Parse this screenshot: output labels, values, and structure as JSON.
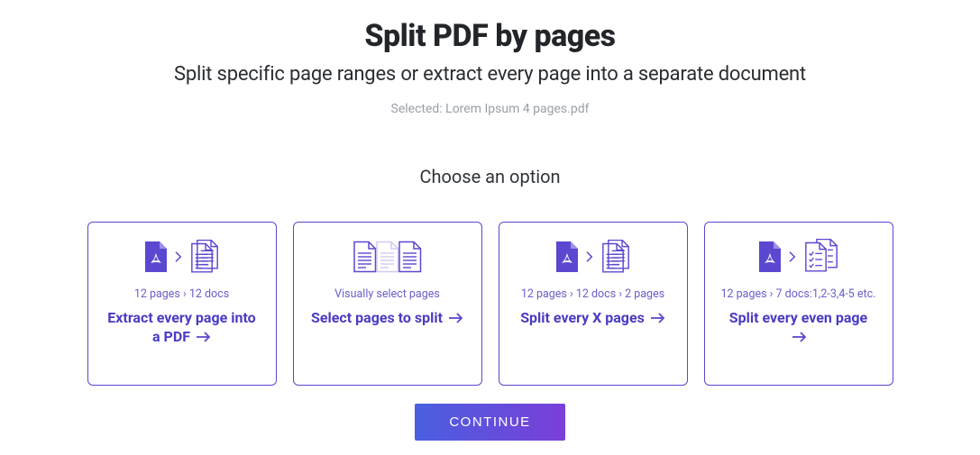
{
  "header": {
    "title": "Split PDF by pages",
    "subtitle": "Split specific page ranges or extract every page into a separate document",
    "selected": "Selected: Lorem Ipsum 4 pages.pdf"
  },
  "choose_label": "Choose an option",
  "cards": [
    {
      "desc": "12 pages › 12 docs",
      "title": "Extract every page into a PDF"
    },
    {
      "desc": "Visually select pages",
      "title": "Select pages to split"
    },
    {
      "desc": "12 pages › 12 docs › 2 pages",
      "title": "Split every X pages"
    },
    {
      "desc": "12 pages › 7 docs:1,2-3,4-5 etc.",
      "title": "Split every even page"
    }
  ],
  "continue_label": "CONTINUE",
  "colors": {
    "primary": "#5b48d0",
    "light": "#d1caf2"
  }
}
